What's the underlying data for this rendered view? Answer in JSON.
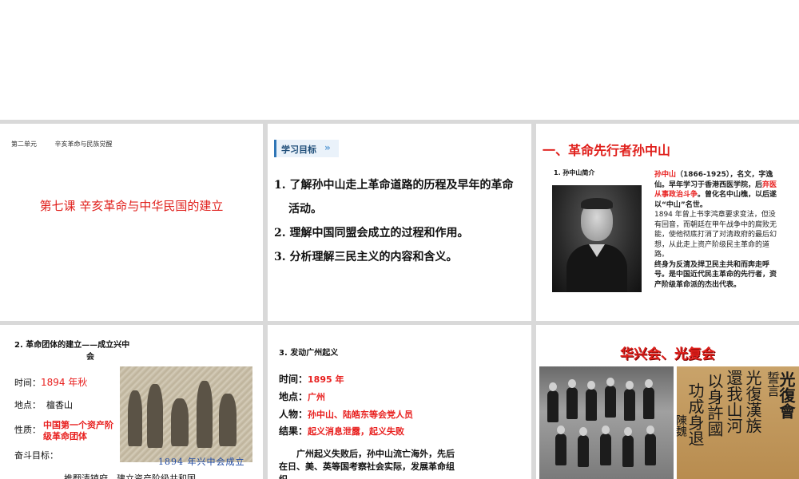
{
  "slide1": {
    "unit_label": "第二单元",
    "unit_title": "辛亥革命与民族觉醒",
    "lesson_title": "第七课  辛亥革命与中华民国的建立"
  },
  "slide2": {
    "tag": "学习目标",
    "goals": [
      "1. 了解孙中山走上革命道路的历程及早年的革命活动。",
      "2. 理解中国同盟会成立的过程和作用。",
      "3. 分析理解三民主义的内容和含义。"
    ]
  },
  "slide3": {
    "title": "一、革命先行者孙中山",
    "subtitle": "1. 孙中山简介",
    "bio_name": "孙中山",
    "bio_1": "（1866-1925），名文，字逸仙。早年学习于香港西医学院，后",
    "bio_highlight": "弃医从事政治斗争",
    "bio_2": "。曾化名中山樵，以后遂以“中山”名世。",
    "bio_3": "1894 年曾上书李鸿章要求变法，但没有回音，而朝廷在甲午战争中的腐败无能，使他彻底打消了对清政府的最后幻想，从此走上资产阶级民主革命的道路。",
    "bio_4": "终身为反清及捍卫民主共和而奔走呼号。是中国近代民主革命的先行者，资产阶级革命派的杰出代表。"
  },
  "slide4": {
    "title_line1": "2. 革命团体的建立——成立兴中",
    "title_line2": "会",
    "time_label": "时间：",
    "time_value": "1894 年秋",
    "place_label": "地点：",
    "place_value": "檀香山",
    "nature_label": "性质：",
    "nature_value": "中国第一个资产阶级革命团体",
    "goal_label": "奋斗目标：",
    "goal_text": "推翻清镇府，建立资产阶级共和国",
    "caption": "1894 年兴中会成立"
  },
  "slide5": {
    "title": "3. 发动广州起义",
    "rows": [
      {
        "label": "时间：",
        "value": "1895 年"
      },
      {
        "label": "地点：",
        "value": "广州"
      },
      {
        "label": "人物：",
        "value": "孙中山、陆皓东等会党人员"
      },
      {
        "label": "结果：",
        "value": "起义消息泄露，起义失败"
      }
    ],
    "paragraph": "广州起义失败后，孙中山流亡海外，先后在日、美、英等国考察社会实际，发展革命组织。"
  },
  "slide6": {
    "title": "华兴会、光复会",
    "calligraphy": [
      "光復會",
      "誓言",
      "光復漢族",
      "還我山河",
      "以身許國",
      "功成身退",
      "陳魏"
    ]
  }
}
